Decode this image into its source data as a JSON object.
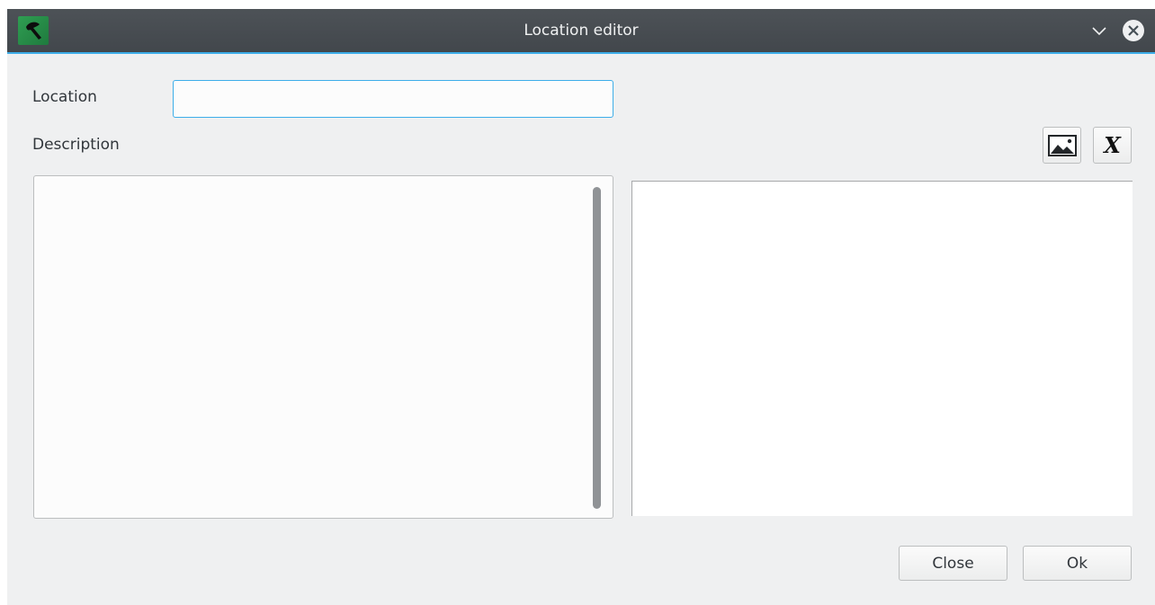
{
  "window": {
    "title": "Location editor",
    "icons": {
      "app": "app-icon",
      "minimize": "chevron-down-icon",
      "close": "close-circle-icon"
    }
  },
  "form": {
    "location_label": "Location",
    "location_value": "",
    "description_label": "Description",
    "description_value": ""
  },
  "toolbar": {
    "insert_image_icon": "image-icon",
    "clear_format_label": "X"
  },
  "buttons": {
    "close_label": "Close",
    "ok_label": "Ok"
  },
  "colors": {
    "titlebar": "#475057",
    "accent": "#3daee9",
    "window_bg": "#eff0f1"
  }
}
